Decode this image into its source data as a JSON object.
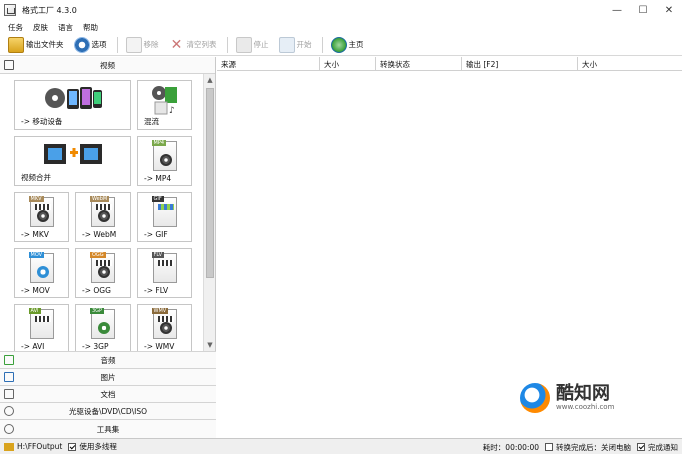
{
  "window": {
    "title": "格式工厂 4.3.0",
    "minimize": "—",
    "maximize": "☐",
    "close": "✕"
  },
  "menu": {
    "items": [
      "任务",
      "皮肤",
      "语言",
      "帮助"
    ]
  },
  "toolbar": {
    "output_folder": "输出文件夹",
    "options": "选项",
    "remove": "移除",
    "clear_list": "清空列表",
    "stop": "停止",
    "start": "开始",
    "home": "主页"
  },
  "left": {
    "video_header": "视频",
    "tiles": [
      {
        "label": "-> 移动设备",
        "icon": "mobile-devices-icon"
      },
      {
        "label": "混流",
        "icon": "mux-icon"
      },
      {
        "label": "视频合并",
        "icon": "video-merge-icon"
      },
      {
        "label": "-> MP4",
        "icon": "mp4-icon",
        "badge": "MP4"
      },
      {
        "label": "-> MKV",
        "icon": "mkv-icon",
        "badge": "MKV"
      },
      {
        "label": "-> WebM",
        "icon": "webm-icon",
        "badge": "WebM"
      },
      {
        "label": "-> GIF",
        "icon": "gif-icon",
        "badge": "GIF"
      },
      {
        "label": "-> MOV",
        "icon": "mov-icon",
        "badge": "MOV"
      },
      {
        "label": "-> OGG",
        "icon": "ogg-icon",
        "badge": "OGG"
      },
      {
        "label": "-> FLV",
        "icon": "flv-icon",
        "badge": "FLV"
      },
      {
        "label": "-> AVI",
        "icon": "avi-icon",
        "badge": "AVI"
      },
      {
        "label": "-> 3GP",
        "icon": "3gp-icon",
        "badge": "3GP"
      },
      {
        "label": "-> WMV",
        "icon": "wmv-icon",
        "badge": "WMV"
      }
    ],
    "categories": [
      "音频",
      "图片",
      "文档",
      "光驱设备\\DVD\\CD\\ISO",
      "工具集"
    ]
  },
  "table": {
    "columns": [
      "来源",
      "大小",
      "转换状态",
      "输出 [F2]",
      "大小"
    ]
  },
  "status": {
    "output_path": "H:\\FFOutput",
    "multithread": "使用多线程",
    "elapsed": "耗时：00:00:00",
    "after_convert": "转换完成后：关闭电脑",
    "notify": "完成通知"
  },
  "watermark": {
    "title": "酷知网",
    "url": "www.coozhi.com"
  },
  "colors": {
    "accent": "#2e6fb5",
    "tile_border": "#c6c6c6",
    "statusbar": "#efefef"
  }
}
